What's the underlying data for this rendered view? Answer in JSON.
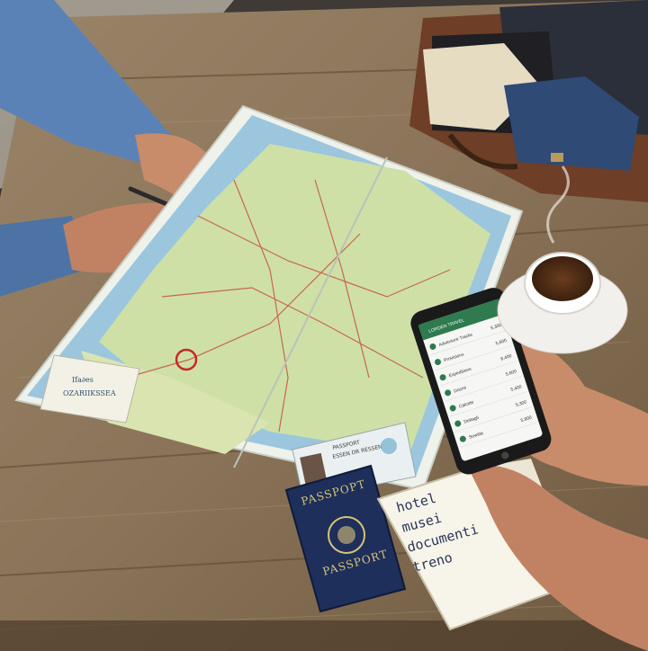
{
  "colors": {
    "table_wood": "#8a7358",
    "table_dark": "#5c4632",
    "map_sea": "#9cc6de",
    "map_land": "#cfe0a6",
    "passport_blue": "#1d2f5a",
    "passport_gold": "#d8c27a",
    "phone_screen": "#f6f7f4",
    "app_green": "#2f7a4e",
    "suitcase_brown": "#6e3e26",
    "shirt_blue": "#2f4a75",
    "shirt_cream": "#e6dcc2",
    "coffee": "#4a2a16",
    "skin": "#c98c6a",
    "sleeve": "#5b82b6"
  },
  "map": {
    "legend_line1": "Ifa∂es",
    "legend_line2": "OZARIIKSSEA"
  },
  "id_card": {
    "line1": "PASSPORT",
    "line2": "ESSEN DR RESSEN"
  },
  "passport": {
    "top_label": "PASSPOPT",
    "bottom_label": "PASSPORT"
  },
  "notebook": {
    "items": [
      "hotel",
      "musei",
      "documenti",
      "treno"
    ]
  },
  "phone": {
    "header": "LORDEN TRAVEL",
    "rows": [
      {
        "label": "Adventure Tracks",
        "value": "5,300"
      },
      {
        "label": "Provisions",
        "value": "5,600"
      },
      {
        "label": "Expeditions",
        "value": "8,400"
      },
      {
        "label": "Docmi",
        "value": "5,600"
      },
      {
        "label": "Calcete",
        "value": "5,400"
      },
      {
        "label": "Dettagli",
        "value": "5,300"
      },
      {
        "label": "Sowitta",
        "value": "5,800"
      }
    ]
  }
}
